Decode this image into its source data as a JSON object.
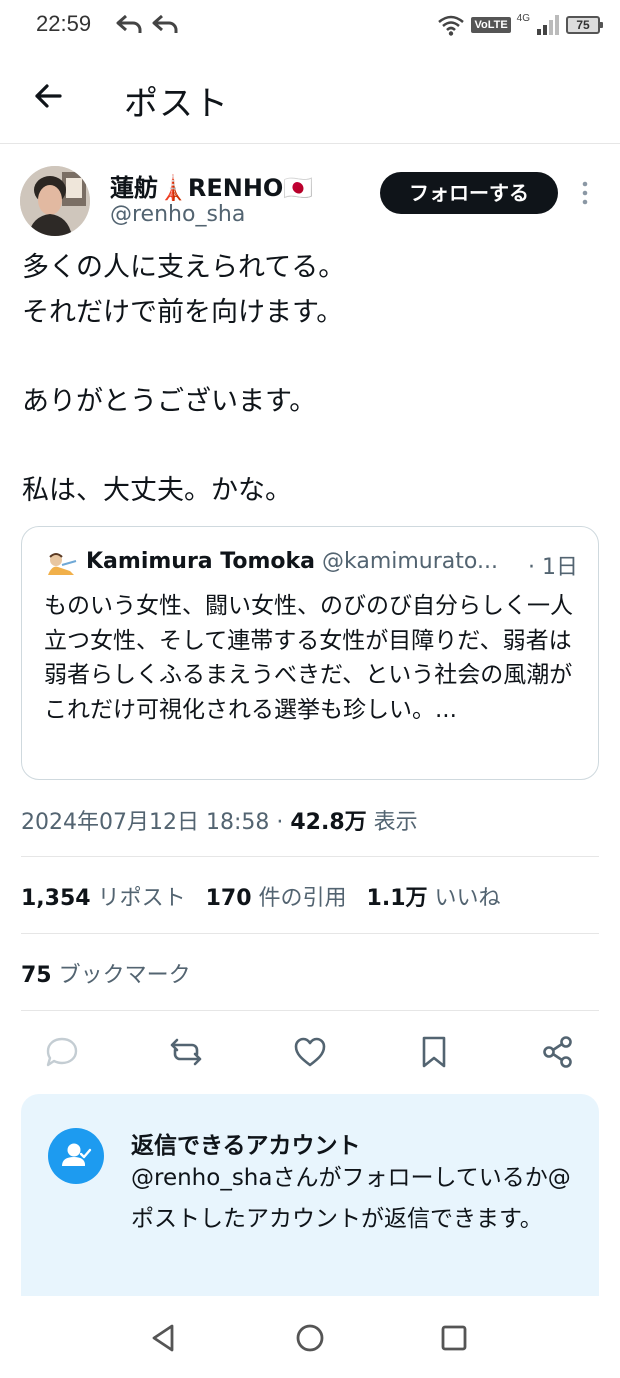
{
  "status_bar": {
    "time": "22:59",
    "network": "4G",
    "volte": "VoLTE",
    "battery": "75"
  },
  "header": {
    "title": "ポスト"
  },
  "author": {
    "name": "蓮舫🗼RENHO🇯🇵",
    "handle": "@renho_sha",
    "follow_label": "フォローする"
  },
  "post": {
    "text": "多くの人に支えられてる。\nそれだけで前を向けます。\n\nありがとうございます。\n\n私は、大丈夫。かな。"
  },
  "quote": {
    "name": "Kamimura Tomoka",
    "handle": "@kamimurato...",
    "time": "· 1日",
    "text": "ものいう女性、闘い女性、のびのび自分らしく一人立つ女性、そして連帯する女性が目障りだ、弱者は弱者らしくふるまえうべきだ、という社会の風潮がこれだけ可視化される選挙も珍しい。..."
  },
  "meta": {
    "datetime": "2024年07月12日 18:58 · ",
    "views": "42.8万",
    "views_label": " 表示"
  },
  "stats": {
    "reposts": "1,354",
    "reposts_label": " リポスト",
    "quotes": "170",
    "quotes_label": " 件の引用",
    "likes": "1.1万",
    "likes_label": " いいね",
    "bookmarks": "75",
    "bookmarks_label": " ブックマーク"
  },
  "reply_notice": {
    "title": "返信できるアカウント",
    "text": "@renho_shaさんがフォローしているか@ポストしたアカウントが返信できます。"
  },
  "colors": {
    "accent": "#1d9bf0",
    "text": "#0f1419",
    "secondary": "#536471",
    "notice_bg": "#e8f5fd"
  }
}
